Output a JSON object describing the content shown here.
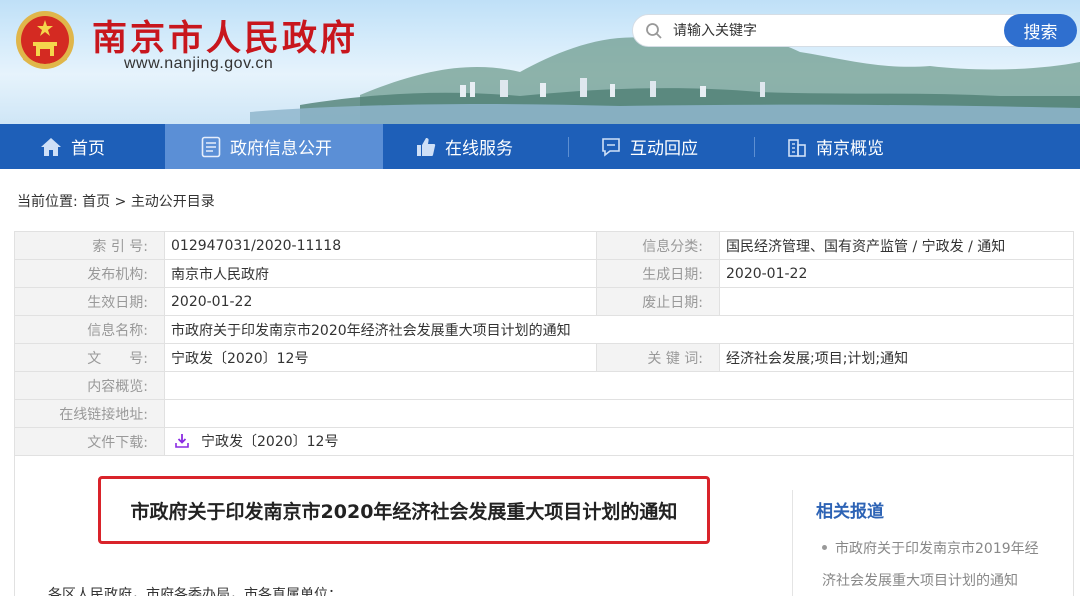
{
  "header": {
    "site_title": "南京市人民政府",
    "site_url": "www.nanjing.gov.cn",
    "search_placeholder": "请输入关键字",
    "search_button": "搜索"
  },
  "nav": {
    "items": [
      {
        "label": "首页",
        "icon": "home-icon"
      },
      {
        "label": "政府信息公开",
        "icon": "document-icon"
      },
      {
        "label": "在线服务",
        "icon": "thumbs-up-icon"
      },
      {
        "label": "互动回应",
        "icon": "chat-icon"
      },
      {
        "label": "南京概览",
        "icon": "building-icon"
      }
    ],
    "active_index": 1
  },
  "breadcrumb": {
    "prefix": "当前位置:",
    "home": "首页",
    "separator": ">",
    "current": "主动公开目录"
  },
  "meta": {
    "index_no_label": "索 引 号:",
    "index_no": "012947031/2020-11118",
    "category_label": "信息分类:",
    "category": "国民经济管理、国有资产监管 / 宁政发 / 通知",
    "publisher_label": "发布机构:",
    "publisher": "南京市人民政府",
    "created_label": "生成日期:",
    "created": "2020-01-22",
    "effective_label": "生效日期:",
    "effective": "2020-01-22",
    "expired_label": "废止日期:",
    "expired": "",
    "name_label": "信息名称:",
    "name": "市政府关于印发南京市2020年经济社会发展重大项目计划的通知",
    "doc_no_label": "文　　号:",
    "doc_no": "宁政发〔2020〕12号",
    "keywords_label": "关 键 词:",
    "keywords": "经济社会发展;项目;计划;通知",
    "summary_label": "内容概览:",
    "summary": "",
    "link_label": "在线链接地址:",
    "link": "",
    "download_label": "文件下载:",
    "download": "宁政发〔2020〕12号"
  },
  "document": {
    "title": "市政府关于印发南京市2020年经济社会发展重大项目计划的通知",
    "lead": "各区人民政府，市府各委办局，市各直属单位："
  },
  "related": {
    "title": "相关报道",
    "items": [
      {
        "line1": "市政府关于印发南京市2019年经",
        "line2": "济社会发展重大项目计划的通知"
      }
    ]
  },
  "colors": {
    "brand_red": "#c8161d",
    "nav_blue": "#1e5fb8",
    "nav_active": "#5b8fd6",
    "link_blue": "#2d63b5",
    "highlight_red": "#d9232a"
  }
}
